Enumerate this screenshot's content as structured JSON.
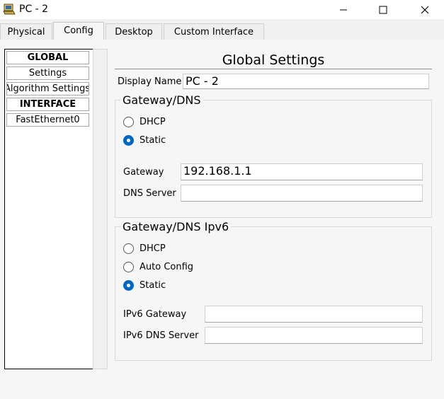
{
  "window": {
    "title": "PC - 2"
  },
  "tabs": [
    "Physical",
    "Config",
    "Desktop",
    "Custom Interface"
  ],
  "sidebar": {
    "items": [
      "GLOBAL",
      "Settings",
      "Algorithm Settings",
      "INTERFACE",
      "FastEthernet0"
    ]
  },
  "main": {
    "title": "Global Settings",
    "display_name_label": "Display Name",
    "display_name_value": "PC - 2",
    "ipv4": {
      "title": "Gateway/DNS",
      "dhcp_label": "DHCP",
      "static_label": "Static",
      "selected": "Static",
      "gateway_label": "Gateway",
      "gateway_value": "192.168.1.1",
      "dns_label": "DNS Server",
      "dns_value": ""
    },
    "ipv6": {
      "title": "Gateway/DNS Ipv6",
      "dhcp_label": "DHCP",
      "auto_label": "Auto Config",
      "static_label": "Static",
      "selected": "Static",
      "gateway_label": "IPv6 Gateway",
      "gateway_value": "",
      "dns_label": "IPv6 DNS Server",
      "dns_value": ""
    }
  }
}
